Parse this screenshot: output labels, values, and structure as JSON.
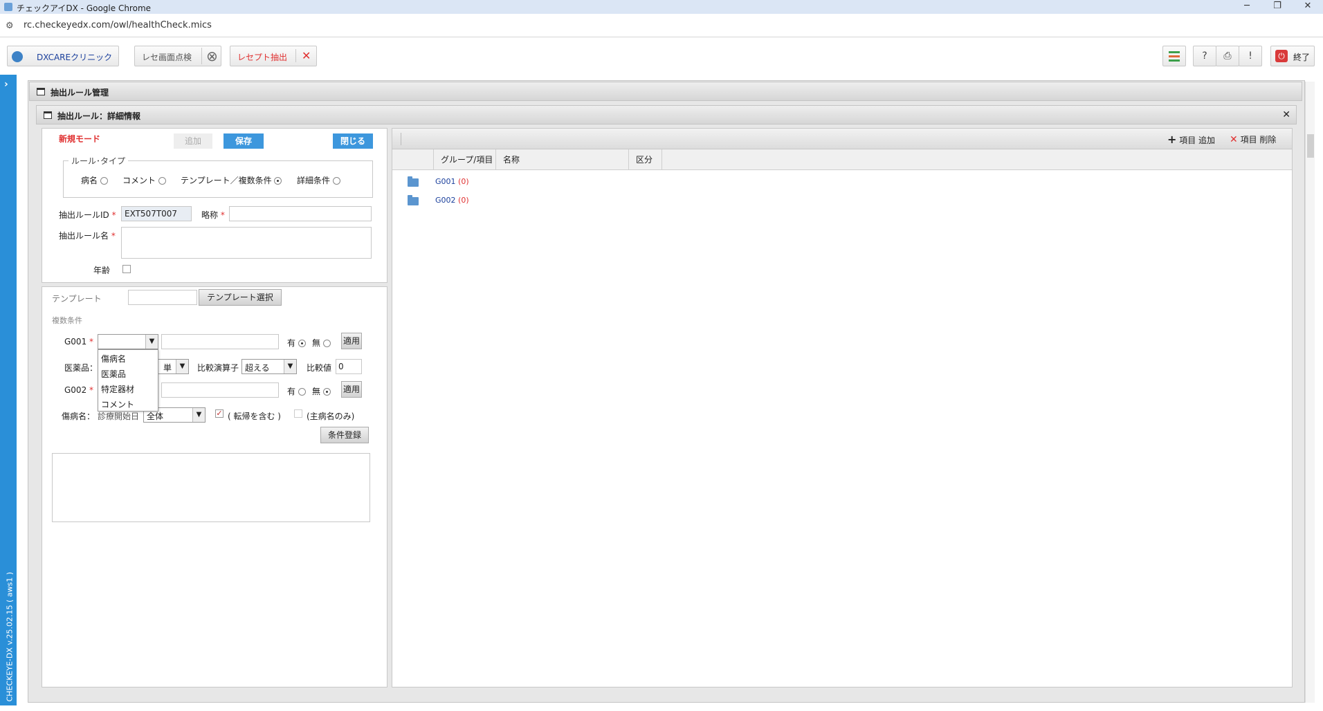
{
  "browser": {
    "window_title": "チェックアイDX - Google Chrome",
    "url": "rc.checkeyedx.com/owl/healthCheck.mics",
    "min_glyph": "─",
    "restore_glyph": "❐",
    "close_glyph": "✕",
    "tune_icon": "⚙"
  },
  "toolbar": {
    "clinic_label": "DXCAREクリニック",
    "rece_check_label": "レセ画面点検",
    "receipt_extract_label": "レセプト抽出",
    "exit_label": "終了",
    "circle_x": "⊗",
    "red_x": "✕",
    "help_icon": "?",
    "print_icon": "⎙",
    "alert_icon": "!",
    "power_icon": "⏻"
  },
  "sidebar": {
    "expand_glyph": "›",
    "version": "CHECKEYE-DX v.25.02.15 ( aws1 )"
  },
  "outer_panel": {
    "title": "抽出ルール管理"
  },
  "detail_panel": {
    "title": "抽出ルール：詳細情報",
    "close_glyph": "✕"
  },
  "form": {
    "mode": "新規モード",
    "add_label": "追加",
    "save_label": "保存",
    "close_label": "閉じる",
    "rule_type_legend": "ルール･タイプ",
    "rule_types": [
      {
        "label": "病名",
        "selected": false
      },
      {
        "label": "コメント",
        "selected": false
      },
      {
        "label": "テンプレート／複数条件",
        "selected": true
      },
      {
        "label": "詳細条件",
        "selected": false
      }
    ],
    "rule_id_label": "抽出ルールID",
    "rule_id_value": "EXT507T007",
    "short_name_label": "略称",
    "short_name_value": "",
    "rule_name_label": "抽出ルール名",
    "rule_name_value": "",
    "age_label": "年齢",
    "required_mark": "*"
  },
  "conditions": {
    "template_label": "テンプレート",
    "template_value": "",
    "template_select_label": "テンプレート選択",
    "multi_label": "複数条件",
    "g001_label": "G001",
    "g001_select": "",
    "g001_text": "",
    "g001_yes_label": "有",
    "g001_yes": true,
    "g001_no_label": "無",
    "g001_no": false,
    "apply_label": "適用",
    "dropdown_options": [
      "傷病名",
      "医薬品",
      "特定器材",
      "コメント"
    ],
    "drug_label": "医薬品：",
    "drug_select_partial": "単",
    "compare_op_label": "比較演算子",
    "compare_op_value": "超える",
    "compare_val_label": "比較値",
    "compare_val_value": "0",
    "g002_label": "G002",
    "g002_text": "",
    "g002_yes_label": "有",
    "g002_yes": false,
    "g002_no_label": "無",
    "g002_no": true,
    "disease_label": "傷病名：",
    "disease_start_label": "診療開始日",
    "disease_select_value": "全体",
    "include_outcome_label": "( 転帰を含む )",
    "include_outcome_checked": true,
    "main_only_label": "(主病名のみ)",
    "main_only_checked": false,
    "register_label": "条件登録",
    "select_arrow": "▼"
  },
  "right_panel": {
    "add_item_label": "項目 追加",
    "delete_item_label": "項目 削除",
    "plus_glyph": "+",
    "x_glyph": "✕",
    "columns": [
      "グループ/項目",
      "名称",
      "区分"
    ],
    "groups": [
      {
        "id": "G001",
        "count": "(0)"
      },
      {
        "id": "G002",
        "count": "(0)"
      }
    ]
  }
}
